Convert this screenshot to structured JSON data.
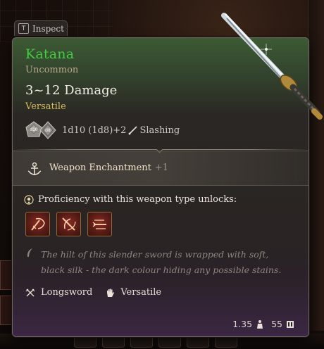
{
  "inspect_hint": {
    "key": "T",
    "label": "Inspect"
  },
  "item": {
    "name": "Katana",
    "rarity": "Uncommon",
    "damage": "3~12 Damage",
    "damage_property": "Versatile",
    "dice": [
      "d10",
      "d8"
    ],
    "dice_formula": "1d10 (1d8)+2",
    "damage_type": "Slashing",
    "enchantment": {
      "label": "Weapon Enchantment",
      "value": "+1"
    },
    "proficiency_label": "Proficiency with this weapon type unlocks:",
    "actions": [
      {
        "icon": "flourish-action-icon"
      },
      {
        "icon": "cleave-action-icon"
      },
      {
        "icon": "slash-action-icon"
      }
    ],
    "description": "The hilt of this slender sword is wrapped with soft, black silk - the dark colour hiding any possible stains.",
    "properties": [
      {
        "icon": "crossed-swords-icon",
        "label": "Longsword"
      },
      {
        "icon": "hand-icon",
        "label": "Versatile"
      }
    ],
    "weight": "1.35",
    "value": "55"
  },
  "colors": {
    "name": "#3fcf3f",
    "rarity": "#b8a98a",
    "damage_property": "#d9b95a",
    "description": "#8d857d"
  }
}
